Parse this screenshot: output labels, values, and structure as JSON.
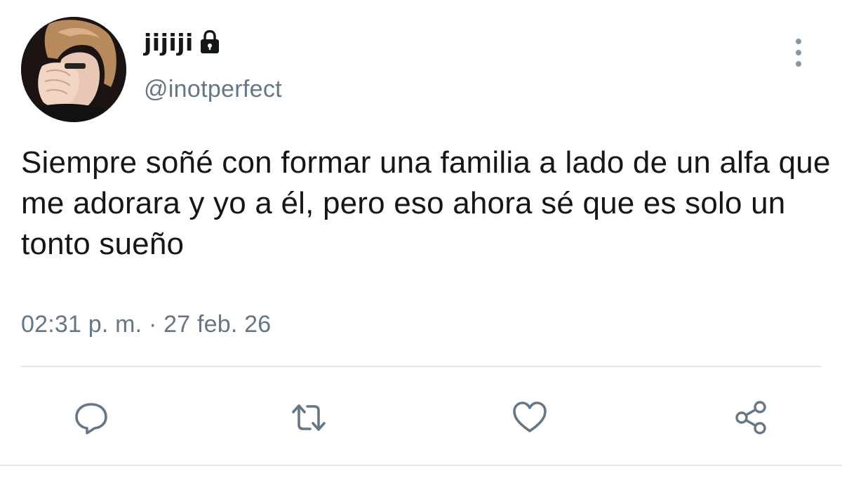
{
  "user": {
    "display_name": "jijiji",
    "handle": "@inotperfect",
    "protected_icon": "lock-icon"
  },
  "tweet": {
    "text": "Siempre soñé con formar una familia a lado de un alfa que me adorara y yo a él, pero eso ahora sé que es solo un tonto sueño",
    "time": "02:31 p. m.",
    "separator": "·",
    "date": "27 feb. 26"
  },
  "actions": [
    {
      "name": "reply",
      "icon": "reply-icon"
    },
    {
      "name": "retweet",
      "icon": "retweet-icon"
    },
    {
      "name": "like",
      "icon": "heart-icon"
    },
    {
      "name": "share",
      "icon": "share-icon"
    }
  ],
  "colors": {
    "text": "#14171a",
    "secondary": "#657786",
    "divider": "#e1e8ed"
  }
}
